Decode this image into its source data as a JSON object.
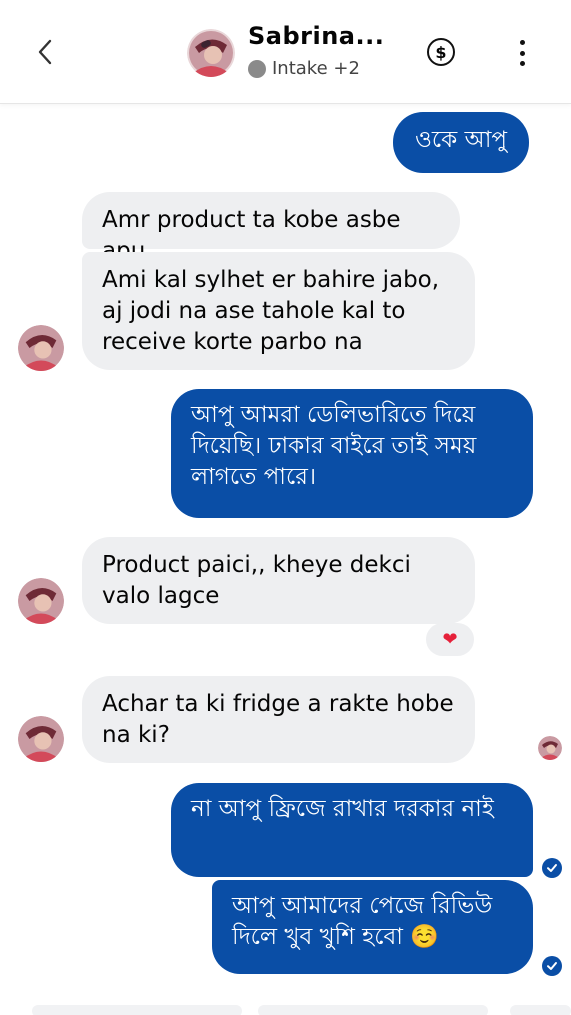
{
  "header": {
    "title": "Sabrina...",
    "status_label": "Intake +2"
  },
  "icons": {
    "back": "chevron-left-icon",
    "payment": "dollar-icon",
    "more": "more-vertical-icon",
    "read": "check-circle-icon",
    "reaction": "heart-icon"
  },
  "colors": {
    "outgoing_bubble": "#0a4ea6",
    "incoming_bubble": "#eeeff1",
    "reaction_heart": "#e5203a"
  },
  "messages": [
    {
      "direction": "out",
      "text": "ওকে আপু"
    },
    {
      "direction": "in",
      "text": "Amr product ta kobe asbe apu"
    },
    {
      "direction": "in",
      "text": "Ami kal sylhet er bahire jabo, aj jodi na ase tahole kal to receive korte parbo na"
    },
    {
      "direction": "out",
      "text": "আপু আমরা ডেলিভারিতে দিয়ে দিয়েছি। ঢাকার বাইরে তাই সময় লাগতে পারে।"
    },
    {
      "direction": "in",
      "text": "Product paici,, kheye dekci valo lagce",
      "reaction": "❤"
    },
    {
      "direction": "in",
      "text": "Achar ta ki fridge a rakte hobe na ki?"
    },
    {
      "direction": "out",
      "text": "না আপু ফ্রিজে রাখার দরকার নাই"
    },
    {
      "direction": "out",
      "text": "আপু আমাদের পেজে রিভিউ দিলে খুব খুশি হবো ☺️"
    }
  ]
}
